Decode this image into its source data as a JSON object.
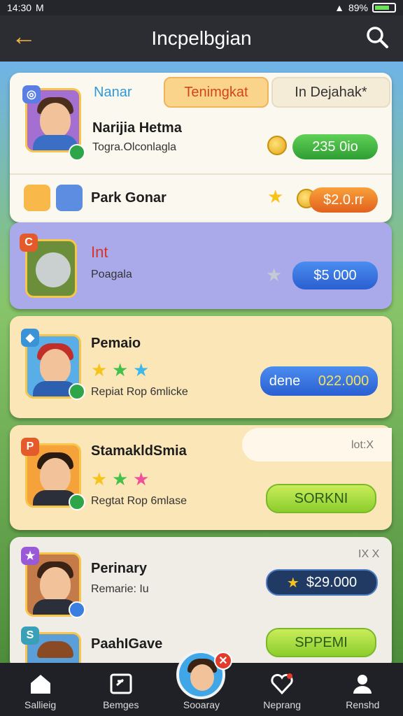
{
  "status_bar": {
    "time": "14:30",
    "carrier": "M",
    "battery": "89%"
  },
  "header": {
    "title": "Incpelbgian"
  },
  "top_card": {
    "tab_label": "Nanar",
    "tab_active": "Tenimgkat",
    "tab_inactive": "In Dejahak*",
    "item1": {
      "name": "Narijia Hetma",
      "subtitle": "Togra.Olconlagla",
      "price": "235 0io",
      "price_color": "#2f9e33"
    },
    "item2": {
      "name": "Park Gonar",
      "price": "$2.0.rr",
      "price_color": "#e2611d"
    }
  },
  "purple_card": {
    "name": "Int",
    "subtitle": "Poagala",
    "price": "$5 000"
  },
  "yellow_card_1": {
    "name": "Pemaio",
    "subtitle": "Repiat Rop 6mlicke",
    "action_label": "dene",
    "price": "022.000"
  },
  "yellow_card_2": {
    "name": "StamakldSmia",
    "subtitle": "Regtat Rop 6mlase",
    "info": "lot:X",
    "button": "SORKNI"
  },
  "gray_card": {
    "item1": {
      "name": "Perinary",
      "subtitle": "Remarie: Iu",
      "price": "$29.000",
      "close": "IX X"
    },
    "item2": {
      "name": "PaahIGave",
      "button": "SPPEMI"
    }
  },
  "bottom_nav": [
    {
      "label": "Sallieig",
      "icon": "home-icon"
    },
    {
      "label": "Bemges",
      "icon": "game-icon"
    },
    {
      "label": "Sooaray",
      "icon": "profile-avatar"
    },
    {
      "label": "Neprang",
      "icon": "heart-icon"
    },
    {
      "label": "Renshd",
      "icon": "user-icon"
    }
  ],
  "colors": {
    "accent": "#f3b53a",
    "header_bg": "#2b2d33",
    "purple_card": "#aaa9ea",
    "yellow_card": "#fbe6b8"
  }
}
